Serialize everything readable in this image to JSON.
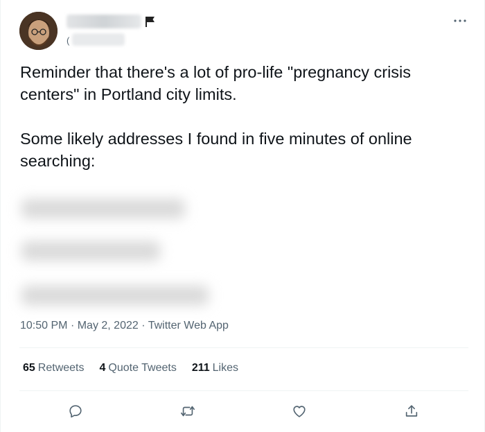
{
  "tweet": {
    "paragraphs": [
      "Reminder that there's a lot of pro-life \"pregnancy crisis centers\" in Portland city limits.",
      "Some likely addresses I found in five minutes of online searching:"
    ],
    "handle_prefix": "(",
    "time": "10:50 PM",
    "date": "May 2, 2022",
    "source": "Twitter Web App",
    "separator": "·"
  },
  "stats": {
    "retweets_count": "65",
    "retweets_label": "Retweets",
    "quotes_count": "4",
    "quotes_label": "Quote Tweets",
    "likes_count": "211",
    "likes_label": "Likes"
  },
  "icons": {
    "more": "more-icon",
    "reply": "reply-icon",
    "retweet": "retweet-icon",
    "like": "heart-icon",
    "share": "share-icon",
    "flag": "flag-icon"
  },
  "colors": {
    "text": "#0f1419",
    "secondary": "#536471",
    "divider": "#eff3f4"
  }
}
